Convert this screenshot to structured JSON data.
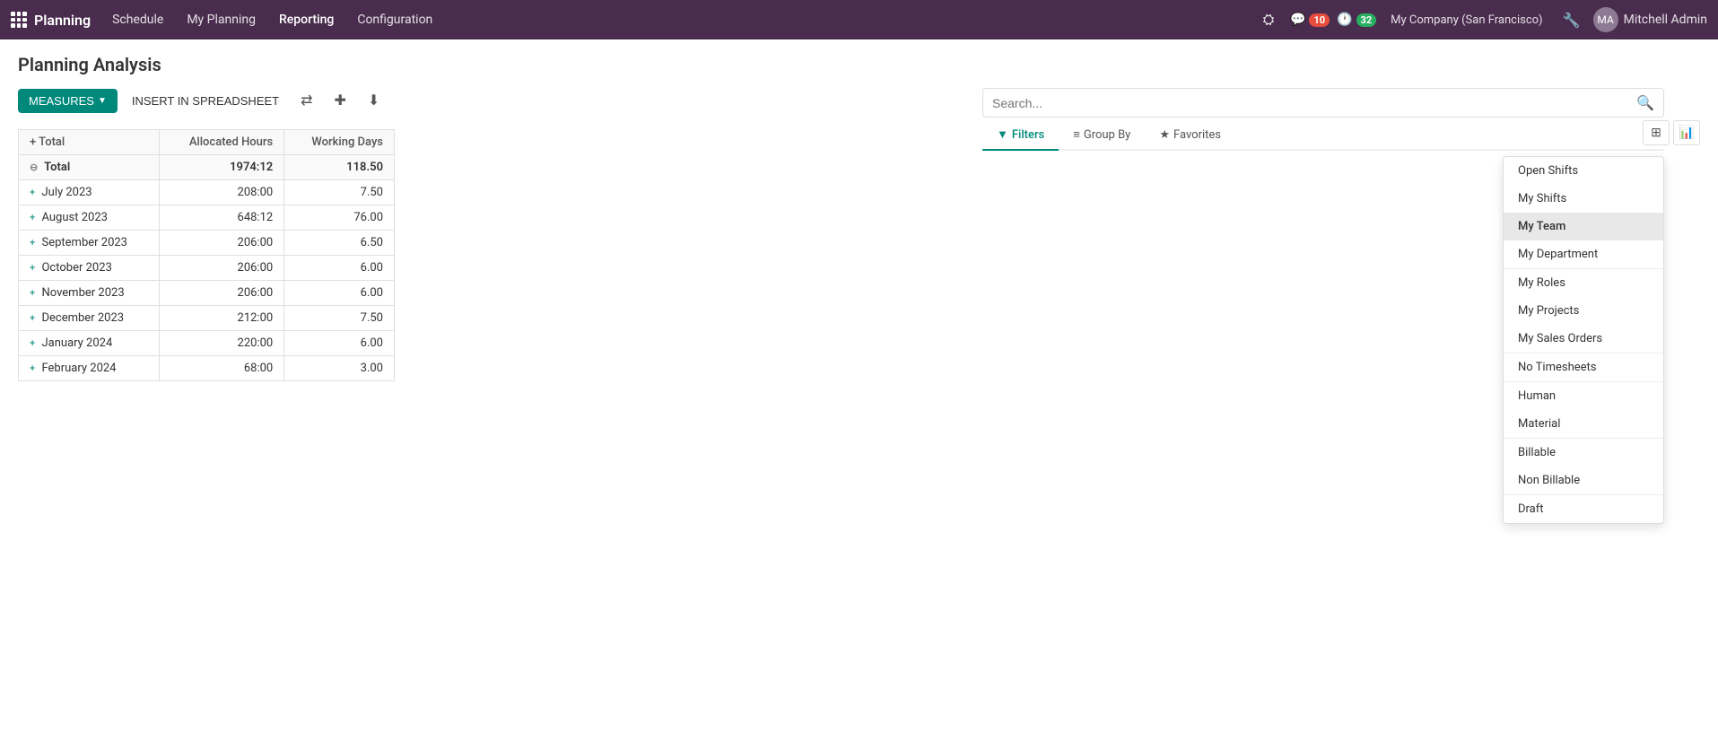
{
  "app": {
    "brand_name": "Planning",
    "nav_items": [
      {
        "id": "schedule",
        "label": "Schedule"
      },
      {
        "id": "my-planning",
        "label": "My Planning"
      },
      {
        "id": "reporting",
        "label": "Reporting",
        "active": true
      },
      {
        "id": "configuration",
        "label": "Configuration"
      }
    ]
  },
  "topbar": {
    "notifications_count": "10",
    "activity_count": "32",
    "company": "My Company (San Francisco)",
    "user": "Mitchell Admin"
  },
  "page": {
    "title": "Planning Analysis"
  },
  "toolbar": {
    "measures_label": "MEASURES",
    "insert_spreadsheet_label": "INSERT IN SPREADSHEET"
  },
  "search": {
    "placeholder": "Search..."
  },
  "filter_tabs": [
    {
      "id": "filters",
      "label": "Filters",
      "active": true,
      "icon": "▼"
    },
    {
      "id": "group-by",
      "label": "Group By",
      "active": false,
      "icon": "≡"
    },
    {
      "id": "favorites",
      "label": "Favorites",
      "active": false,
      "icon": "★"
    }
  ],
  "filters_dropdown": {
    "groups": [
      {
        "items": [
          {
            "id": "open-shifts",
            "label": "Open Shifts",
            "selected": false
          },
          {
            "id": "my-shifts",
            "label": "My Shifts",
            "selected": false
          },
          {
            "id": "my-team",
            "label": "My Team",
            "selected": true
          },
          {
            "id": "my-department",
            "label": "My Department",
            "selected": false
          }
        ]
      },
      {
        "items": [
          {
            "id": "my-roles",
            "label": "My Roles",
            "selected": false
          },
          {
            "id": "my-projects",
            "label": "My Projects",
            "selected": false
          },
          {
            "id": "my-sales-orders",
            "label": "My Sales Orders",
            "selected": false
          }
        ]
      },
      {
        "items": [
          {
            "id": "no-timesheets",
            "label": "No Timesheets",
            "selected": false
          }
        ]
      },
      {
        "items": [
          {
            "id": "human",
            "label": "Human",
            "selected": false
          },
          {
            "id": "material",
            "label": "Material",
            "selected": false
          }
        ]
      },
      {
        "items": [
          {
            "id": "billable",
            "label": "Billable",
            "selected": false
          },
          {
            "id": "non-billable",
            "label": "Non Billable",
            "selected": false
          }
        ]
      },
      {
        "items": [
          {
            "id": "draft",
            "label": "Draft",
            "selected": false
          }
        ]
      }
    ]
  },
  "table": {
    "total_label": "Total",
    "columns": [
      "Allocated Hours",
      "Working Days"
    ],
    "total_row": {
      "expand_icon": "⊖",
      "label": "Total",
      "allocated_hours": "1974:12",
      "working_days": "118.50"
    },
    "rows": [
      {
        "expand_icon": "+",
        "label": "July 2023",
        "allocated_hours": "208:00",
        "working_days": "7.50"
      },
      {
        "expand_icon": "+",
        "label": "August 2023",
        "allocated_hours": "648:12",
        "working_days": "76.00"
      },
      {
        "expand_icon": "+",
        "label": "September 2023",
        "allocated_hours": "206:00",
        "working_days": "6.50"
      },
      {
        "expand_icon": "+",
        "label": "October 2023",
        "allocated_hours": "206:00",
        "working_days": "6.00"
      },
      {
        "expand_icon": "+",
        "label": "November 2023",
        "allocated_hours": "206:00",
        "working_days": "6.00"
      },
      {
        "expand_icon": "+",
        "label": "December 2023",
        "allocated_hours": "212:00",
        "working_days": "7.50"
      },
      {
        "expand_icon": "+",
        "label": "January 2024",
        "allocated_hours": "220:00",
        "working_days": "6.00"
      },
      {
        "expand_icon": "+",
        "label": "February 2024",
        "allocated_hours": "68:00",
        "working_days": "3.00"
      }
    ]
  }
}
